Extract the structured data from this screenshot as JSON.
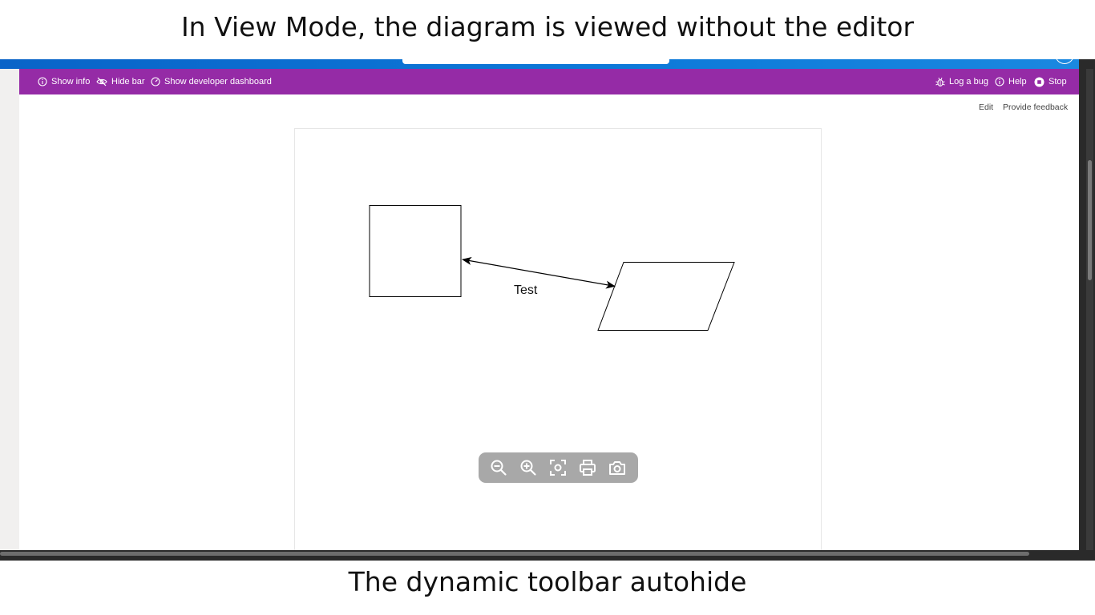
{
  "captions": {
    "top": "In View Mode, the diagram is viewed without the editor",
    "bottom": "The dynamic toolbar autohide"
  },
  "dev_bar": {
    "background": "#952ba6",
    "left_items": [
      {
        "label": "Show info",
        "icon": "info-icon"
      },
      {
        "label": "Hide bar",
        "icon": "eye-off-icon"
      },
      {
        "label": "Show developer dashboard",
        "icon": "dashboard-gauge-icon"
      }
    ],
    "right_items": [
      {
        "label": "Log a bug",
        "icon": "bug-icon"
      },
      {
        "label": "Help",
        "icon": "info-icon"
      },
      {
        "label": "Stop",
        "icon": "stop-icon"
      }
    ]
  },
  "page_links": {
    "edit": "Edit",
    "feedback": "Provide feedback"
  },
  "diagram": {
    "edge_label": "Test",
    "shapes": [
      "rectangle",
      "parallelogram"
    ],
    "connector": "bidirectional-arrow"
  },
  "viewer_toolbar": {
    "buttons": [
      "zoom-out-icon",
      "zoom-in-icon",
      "fit-screen-icon",
      "print-icon",
      "camera-icon"
    ]
  }
}
